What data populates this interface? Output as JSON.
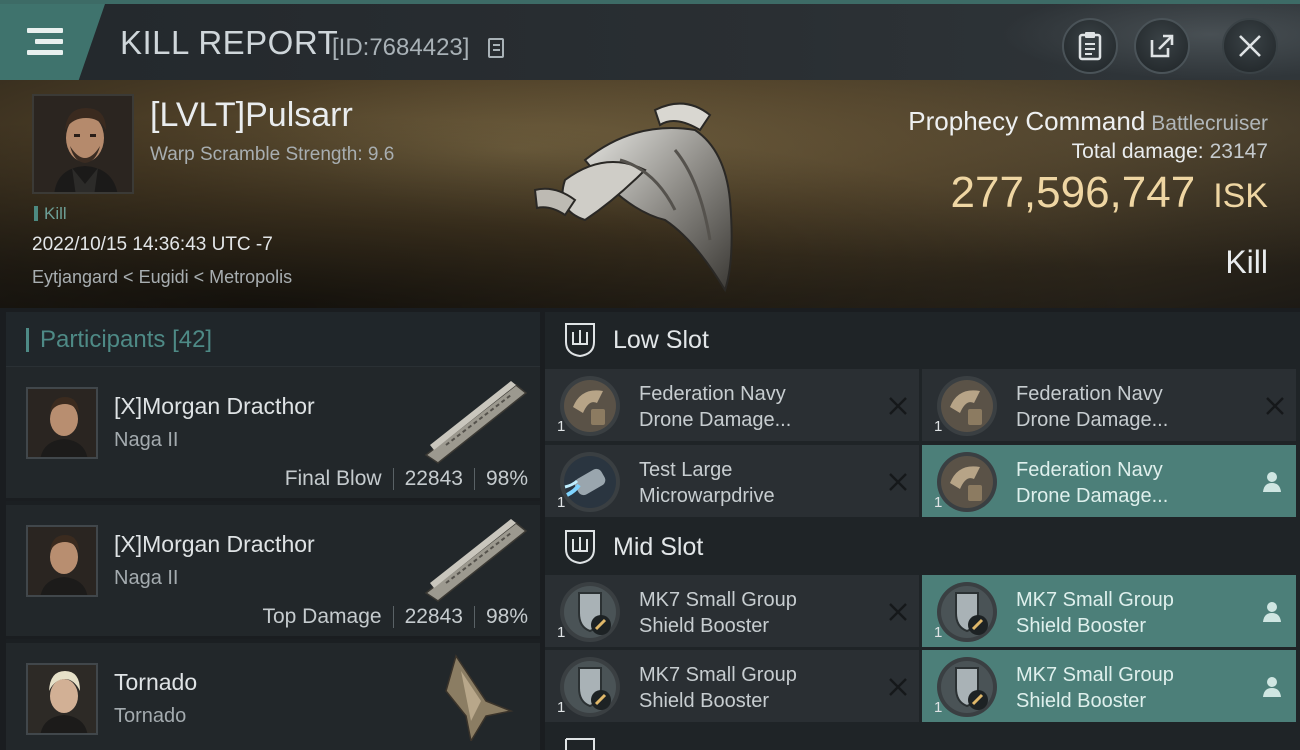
{
  "header": {
    "title": "KILL REPORT",
    "report_id": "[ID:7684423]"
  },
  "victim": {
    "pilot": "[LVLT]Pulsarr",
    "warp_scramble": "Warp Scramble Strength: 9.6",
    "tag": "Kill",
    "datetime": "2022/10/15 14:36:43 UTC -7",
    "location": "Eytjangard < Eugidi < Metropolis",
    "ship_name": "Prophecy Command",
    "ship_class": "Battlecruiser",
    "total_damage_label": "Total damage:",
    "total_damage": "23147",
    "isk_value": "277,596,747",
    "isk_unit": "ISK",
    "result": "Kill"
  },
  "participants": {
    "title": "Participants",
    "count": "[42]",
    "rows": [
      {
        "name": "[X]Morgan Dracthor",
        "ship": "Naga II",
        "label": "Final Blow",
        "damage": "22843",
        "pct": "98%"
      },
      {
        "name": "[X]Morgan Dracthor",
        "ship": "Naga II",
        "label": "Top Damage",
        "damage": "22843",
        "pct": "98%"
      },
      {
        "name": "Tornado",
        "ship": "Tornado",
        "label": "",
        "damage": "",
        "pct": ""
      }
    ]
  },
  "fitting": {
    "low_slot": {
      "title": "Low Slot",
      "modules": [
        {
          "line1": "Federation Navy",
          "line2": "Drone Damage...",
          "qty": "1"
        },
        {
          "line1": "Federation Navy",
          "line2": "Drone Damage...",
          "qty": "1"
        },
        {
          "line1": "Test Large",
          "line2": "Microwarpdrive",
          "qty": "1"
        },
        {
          "line1": "Federation Navy",
          "line2": "Drone Damage...",
          "qty": "1"
        }
      ]
    },
    "mid_slot": {
      "title": "Mid Slot",
      "modules": [
        {
          "line1": "MK7 Small Group",
          "line2": "Shield Booster",
          "qty": "1"
        },
        {
          "line1": "MK7 Small Group",
          "line2": "Shield Booster",
          "qty": "1"
        },
        {
          "line1": "MK7 Small Group",
          "line2": "Shield Booster",
          "qty": "1"
        },
        {
          "line1": "MK7 Small Group",
          "line2": "Shield Booster",
          "qty": "1"
        }
      ]
    }
  },
  "colors": {
    "accent": "#4c7f79",
    "isk_gold": "#efd6a3"
  }
}
